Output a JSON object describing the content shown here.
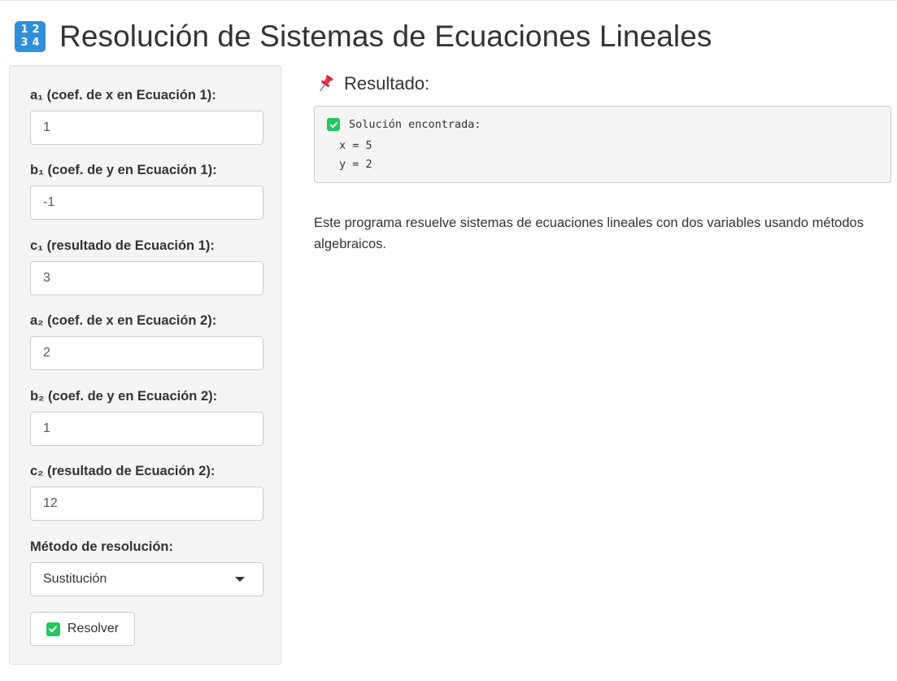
{
  "header": {
    "icon": "numbers-1234-icon",
    "icon_digits": [
      "1",
      "2",
      "3",
      "4"
    ],
    "title": "Resolución de Sistemas de Ecuaciones Lineales"
  },
  "form": {
    "fields": [
      {
        "label": "a₁ (coef. de x en Ecuación 1):",
        "value": "1"
      },
      {
        "label": "b₁ (coef. de y en Ecuación 1):",
        "value": "-1"
      },
      {
        "label": "c₁ (resultado de Ecuación 1):",
        "value": "3"
      },
      {
        "label": "a₂ (coef. de x en Ecuación 2):",
        "value": "2"
      },
      {
        "label": "b₂ (coef. de y en Ecuación 2):",
        "value": "1"
      },
      {
        "label": "c₂ (resultado de Ecuación 2):",
        "value": "12"
      }
    ],
    "method": {
      "label": "Método de resolución:",
      "selected": "Sustitución"
    },
    "submit_label": "Resolver"
  },
  "result": {
    "heading": "Resultado:",
    "status": "Solución encontrada:",
    "x_line": "x = 5",
    "y_line": "y = 2"
  },
  "description": "Este programa resuelve sistemas de ecuaciones lineales con dos variables usando métodos algebraicos.",
  "colors": {
    "accent_blue": "#2f8fd8",
    "check_green": "#22c55e",
    "panel_bg": "#f5f5f5"
  }
}
